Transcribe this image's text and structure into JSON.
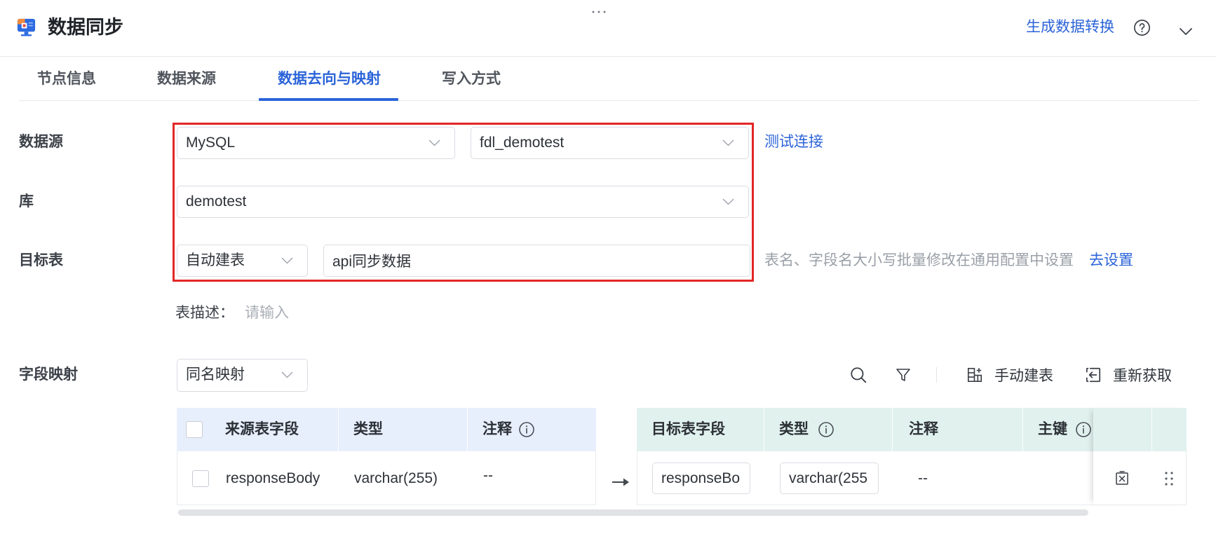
{
  "colors": {
    "accent": "#2c64d8",
    "highlight_box": "#e32626",
    "source_header_bg": "#e8effc",
    "target_header_bg": "#e1f2ee"
  },
  "header": {
    "title": "数据同步",
    "logo_icon": "data-sync-monitor-icon",
    "generate_link": "生成数据转换",
    "help_icon": "question-circle-icon",
    "collapse_icon": "chevron-down-icon"
  },
  "tabs": [
    {
      "label": "节点信息",
      "active": false
    },
    {
      "label": "数据来源",
      "active": false
    },
    {
      "label": "数据去向与映射",
      "active": true
    },
    {
      "label": "写入方式",
      "active": false
    }
  ],
  "form": {
    "datasource": {
      "label": "数据源",
      "type_value": "MySQL",
      "connection_value": "fdl_demotest",
      "test_link": "测试连接"
    },
    "database": {
      "label": "库",
      "value": "demotest"
    },
    "target_table": {
      "label": "目标表",
      "mode_value": "自动建表",
      "name_value": "api同步数据",
      "hint": "表名、字段名大小写批量修改在通用配置中设置",
      "settings_link": "去设置"
    },
    "table_description": {
      "label": "表描述：",
      "placeholder": "请输入"
    },
    "field_mapping": {
      "label": "字段映射",
      "mode_value": "同名映射"
    }
  },
  "mapping_toolbar": {
    "search_icon": "search-icon",
    "filter_icon": "filter-icon",
    "manual_create_icon": "table-add-icon",
    "manual_create_label": "手动建表",
    "refetch_icon": "refresh-icon",
    "refetch_label": "重新获取"
  },
  "source_table": {
    "select_all_checked": false,
    "columns": [
      "来源表字段",
      "类型",
      "注释"
    ],
    "rows": [
      {
        "checked": false,
        "field": "responseBody",
        "type": "varchar(255)",
        "comment": "--"
      }
    ]
  },
  "target_table": {
    "columns": [
      "目标表字段",
      "类型",
      "注释",
      "主键"
    ],
    "rows": [
      {
        "field": "responseBo",
        "type": "varchar(255",
        "comment": "--",
        "delete_icon": "delete-row-icon",
        "drag_icon": "drag-handle-icon"
      }
    ]
  }
}
